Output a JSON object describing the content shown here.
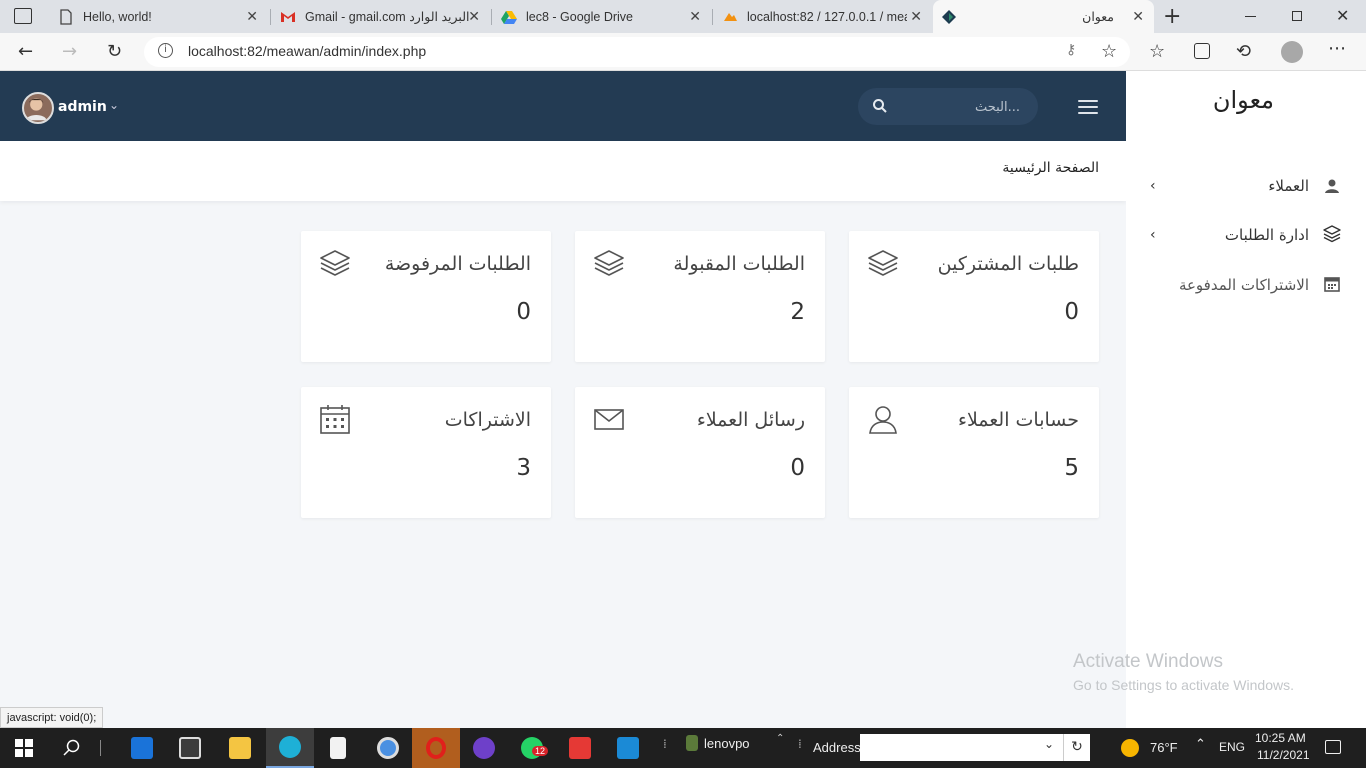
{
  "browser": {
    "tabs": [
      {
        "title": "Hello, world!"
      },
      {
        "title": "البريد الوارد Gmail - gmail.com"
      },
      {
        "title": "lec8 - Google Drive"
      },
      {
        "title": "localhost:82 / 127.0.0.1 / mea"
      },
      {
        "title": "معوان"
      }
    ],
    "url": "localhost:82/meawan/admin/index.php",
    "status_text": "javascript: void(0);"
  },
  "navbar": {
    "user": "admin",
    "search_placeholder": "البحث..."
  },
  "breadcrumb": "الصفحة الرئيسية",
  "cards": [
    {
      "title": "طلبات المشتركين",
      "value": "0",
      "icon": "layers-icon"
    },
    {
      "title": "الطلبات المقبولة",
      "value": "2",
      "icon": "layers-icon"
    },
    {
      "title": "الطلبات المرفوضة",
      "value": "0",
      "icon": "layers-icon"
    },
    {
      "title": "حسابات العملاء",
      "value": "5",
      "icon": "user-icon"
    },
    {
      "title": "رسائل العملاء",
      "value": "0",
      "icon": "envelope-icon"
    },
    {
      "title": "الاشتراكات",
      "value": "3",
      "icon": "calendar-icon"
    }
  ],
  "sidebar": {
    "brand": "معوان",
    "items": [
      {
        "label": "العملاء",
        "icon": "user-icon"
      },
      {
        "label": "ادارة الطلبات",
        "icon": "layers-icon"
      },
      {
        "label": "الاشتراكات المدفوعة",
        "icon": "calendar-icon"
      }
    ]
  },
  "watermark": {
    "line1": "Activate Windows",
    "line2": "Go to Settings to activate Windows."
  },
  "taskbar": {
    "toolbar_user": "lenovpo",
    "address_label": "Address",
    "whatsapp_badge": "12",
    "weather": "76°F",
    "language": "ENG",
    "time": "10:25 AM",
    "date": "11/2/2021"
  },
  "colors": {
    "navbar": "#233b53",
    "page_bg": "#f4f6f9",
    "taskbar": "#1f1f1f"
  }
}
